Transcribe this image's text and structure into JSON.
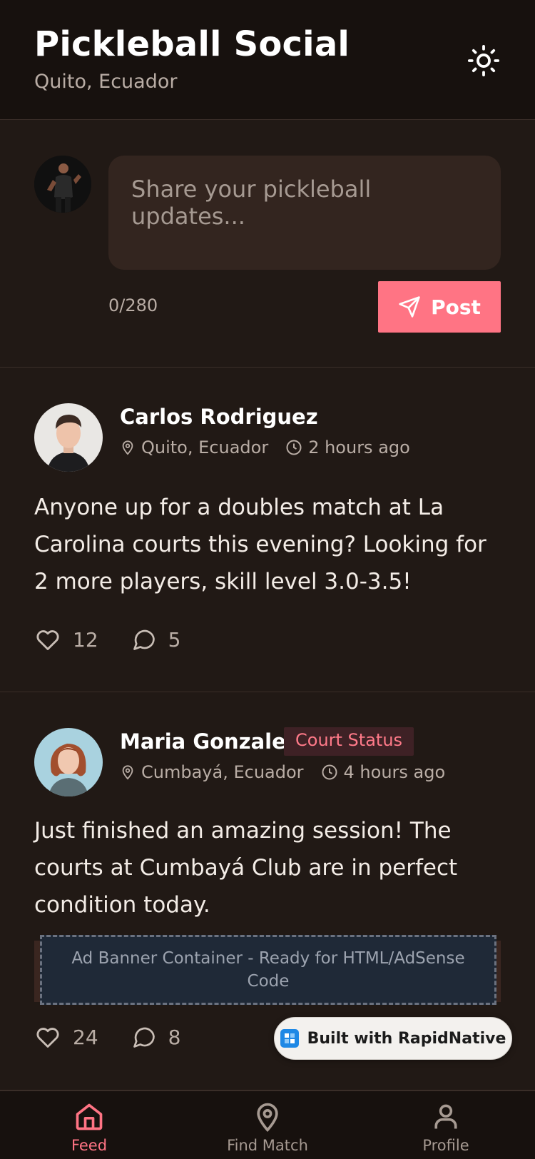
{
  "header": {
    "title": "Pickleball Social",
    "subtitle": "Quito, Ecuador",
    "theme_icon": "sun-icon"
  },
  "composer": {
    "placeholder": "Share your pickleball updates...",
    "value": "",
    "char_count": "0/280",
    "post_label": "Post"
  },
  "posts": [
    {
      "author": "Carlos Rodriguez",
      "location": "Quito, Ecuador",
      "time": "2 hours ago",
      "text": "Anyone up for a doubles match at La Carolina courts this evening? Looking for 2 more players, skill level 3.0-3.5!",
      "likes": "12",
      "comments": "5"
    },
    {
      "author": "Maria Gonzalez",
      "badge": "Court Status",
      "location": "Cumbayá, Ecuador",
      "time": "4 hours ago",
      "text": "Just finished an amazing session! The courts at Cumbayá Club are in perfect condition today.",
      "ad_text": "Ad Banner Container - Ready for HTML/AdSense Code",
      "likes": "24",
      "comments": "8"
    }
  ],
  "built_with": "Built with RapidNative",
  "nav": {
    "items": [
      {
        "label": "Feed",
        "icon": "home-icon",
        "active": true
      },
      {
        "label": "Find Match",
        "icon": "map-pin-icon",
        "active": false
      },
      {
        "label": "Profile",
        "icon": "user-icon",
        "active": false
      }
    ]
  },
  "colors": {
    "background": "#211915",
    "header": "#17110e",
    "accent": "#ff7484",
    "input": "#33251f",
    "badge_bg": "#3e2125"
  }
}
